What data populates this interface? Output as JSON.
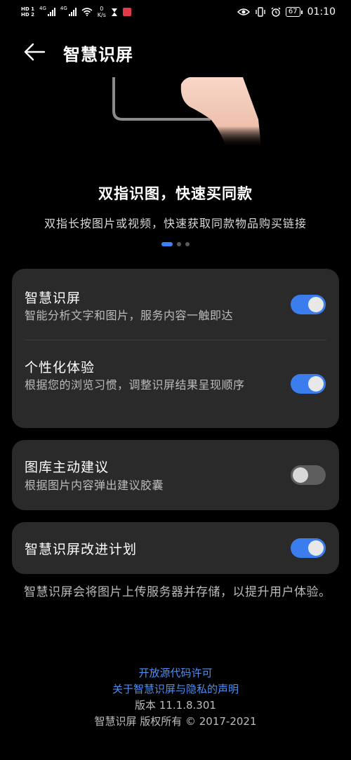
{
  "status_bar": {
    "sim1": "HD 1",
    "sim2": "HD 2",
    "net1": "4G",
    "net2": "4G",
    "speed_value": "0",
    "speed_unit": "K/s",
    "battery": "67",
    "time": "01:10"
  },
  "header": {
    "title": "智慧识屏"
  },
  "banner": {
    "title": "双指识图，快速买同款",
    "subtitle": "双指长按图片或视频，快速获取同款物品购买链接",
    "page_count": 3,
    "active_page": 1
  },
  "settings": {
    "group1": [
      {
        "title": "智慧识屏",
        "desc": "智能分析文字和图片，服务内容一触即达",
        "enabled": true
      },
      {
        "title": "个性化体验",
        "desc": "根据您的浏览习惯，调整识屏结果呈现顺序",
        "enabled": true
      }
    ],
    "group2": [
      {
        "title": "图库主动建议",
        "desc": "根据图片内容弹出建议胶囊",
        "enabled": false
      }
    ],
    "group3": [
      {
        "title": "智慧识屏改进计划",
        "enabled": true
      }
    ]
  },
  "note": "智慧识屏会将图片上传服务器并存储，以提升用户体验。",
  "footer": {
    "open_source_link": "开放源代码许可",
    "privacy_link": "关于智慧识屏与隐私的声明",
    "version": "版本 11.1.8.301",
    "copyright": "智慧识屏 版权所有 © 2017-2021"
  },
  "colors": {
    "accent": "#3b7ded",
    "link": "#4d8ff0",
    "card_bg": "#2a2a2a",
    "page_bg": "#000000"
  }
}
